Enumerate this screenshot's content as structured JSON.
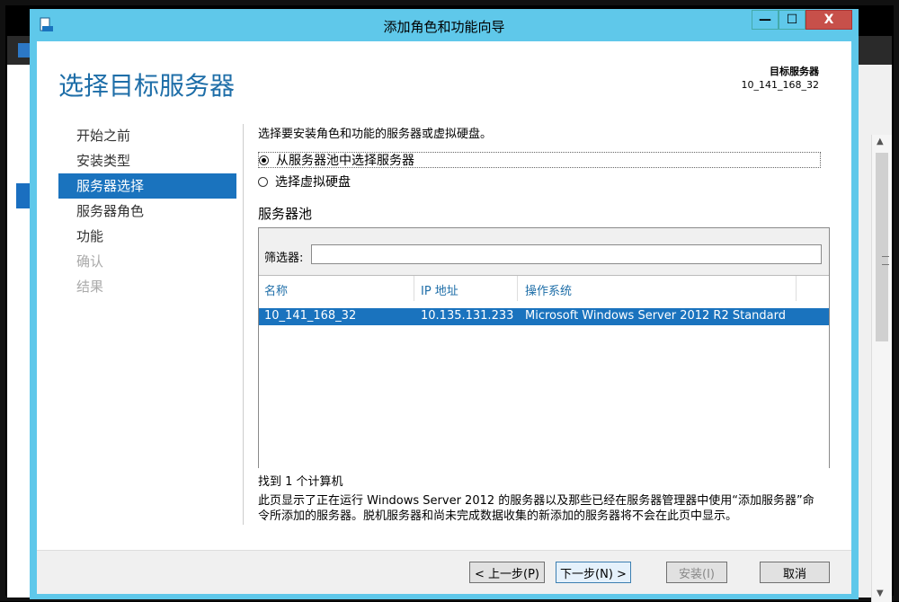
{
  "window": {
    "title": "添加角色和功能向导",
    "controls": {
      "minimize": "—",
      "maximize": "☐",
      "close": "X"
    }
  },
  "header": {
    "page_title": "选择目标服务器",
    "target_server_label": "目标服务器",
    "target_server_value": "10_141_168_32"
  },
  "nav": {
    "items": [
      {
        "label": "开始之前",
        "state": "normal"
      },
      {
        "label": "安装类型",
        "state": "normal"
      },
      {
        "label": "服务器选择",
        "state": "active"
      },
      {
        "label": "服务器角色",
        "state": "normal"
      },
      {
        "label": "功能",
        "state": "normal"
      },
      {
        "label": "确认",
        "state": "disabled"
      },
      {
        "label": "结果",
        "state": "disabled"
      }
    ]
  },
  "main": {
    "instruction": "选择要安装角色和功能的服务器或虚拟硬盘。",
    "radio_pool": "从服务器池中选择服务器",
    "radio_vhd": "选择虚拟硬盘",
    "pool_label": "服务器池",
    "filter_label": "筛选器:",
    "filter_value": "",
    "columns": [
      "名称",
      "IP 地址",
      "操作系统"
    ],
    "rows": [
      {
        "name": "10_141_168_32",
        "ip": "10.135.131.233",
        "os": "Microsoft Windows Server 2012 R2 Standard"
      }
    ],
    "found_text": "找到 1 个计算机",
    "description": "此页显示了正在运行 Windows Server 2012 的服务器以及那些已经在服务器管理器中使用“添加服务器”命令所添加的服务器。脱机服务器和尚未完成数据收集的新添加的服务器将不会在此页中显示。"
  },
  "footer": {
    "prev": "< 上一步(P)",
    "next": "下一步(N) >",
    "install": "安装(I)",
    "cancel": "取消"
  },
  "colors": {
    "accent": "#1a73be",
    "title_bar": "#5fc8ea",
    "close": "#c7504a"
  }
}
